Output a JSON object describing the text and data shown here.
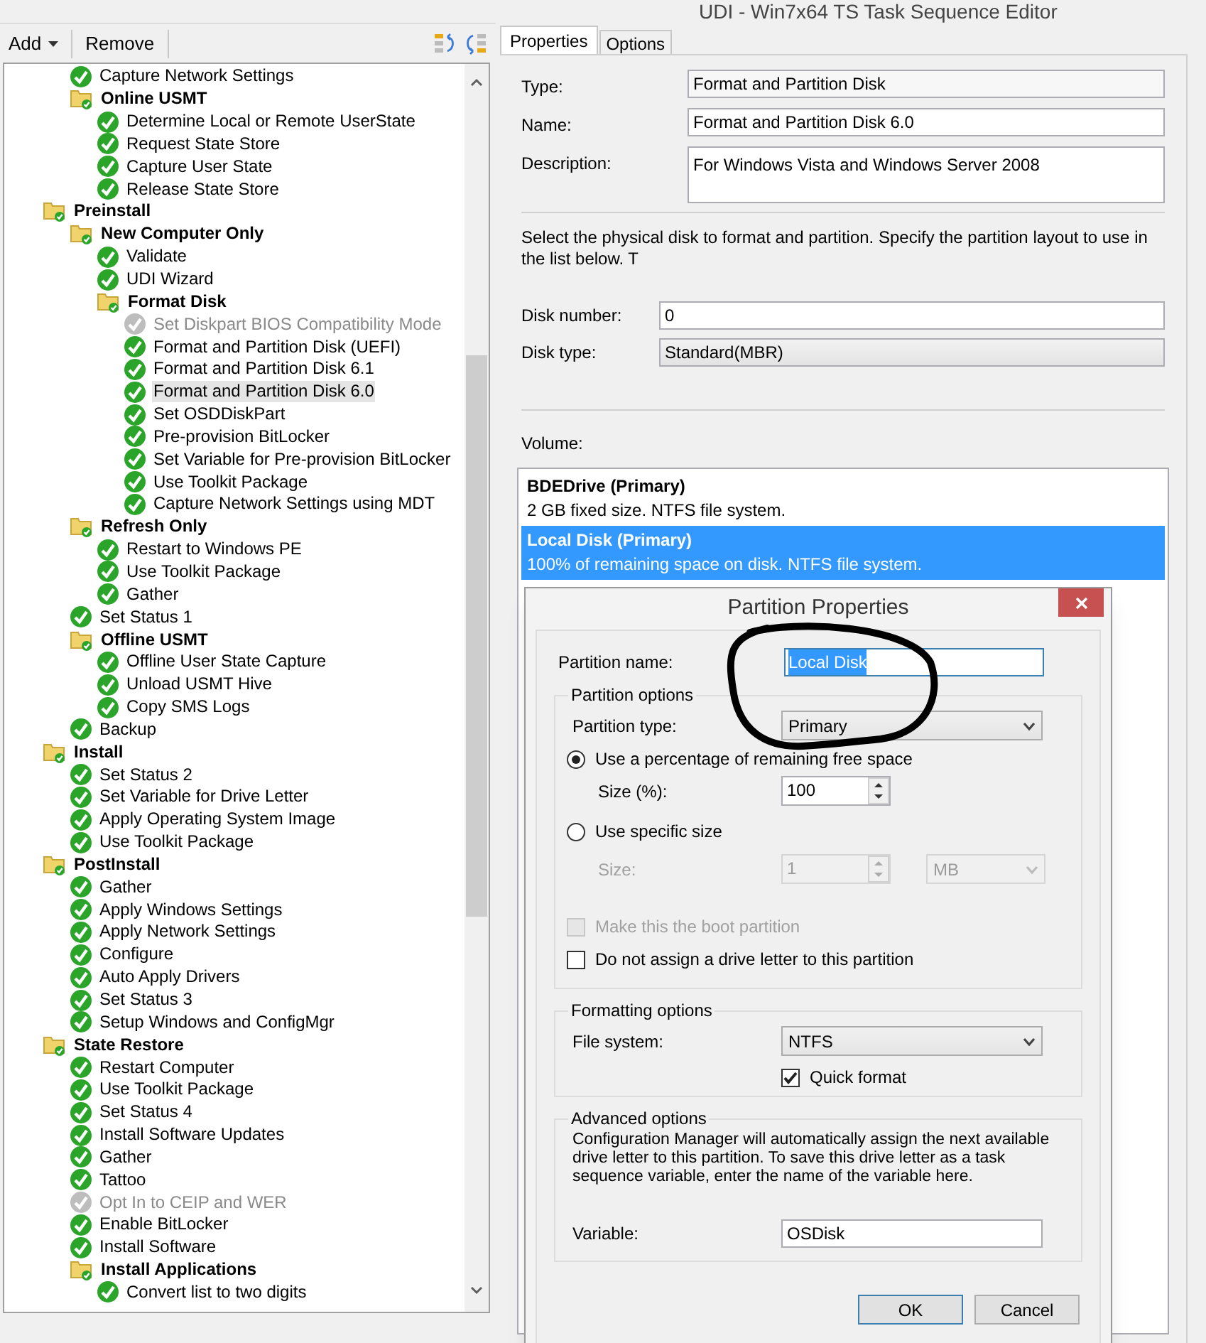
{
  "window": {
    "title": "UDI - Win7x64 TS Task Sequence Editor"
  },
  "toolbar": {
    "buttons": [
      {
        "label": "Add",
        "kind": "dropdown"
      },
      {
        "label": "Remove",
        "kind": "plain"
      }
    ]
  },
  "tree": {
    "partial_branch": [
      {
        "label": "Capture Network Settings",
        "kind": "step",
        "disabled": false,
        "selected": false
      },
      {
        "label": "Online USMT",
        "kind": "group",
        "selected": false,
        "children": [
          {
            "label": "Determine Local or Remote UserState",
            "kind": "step",
            "disabled": false,
            "selected": false
          },
          {
            "label": "Request State Store",
            "kind": "step",
            "disabled": false,
            "selected": false
          },
          {
            "label": "Capture User State",
            "kind": "step",
            "disabled": false,
            "selected": false
          },
          {
            "label": "Release State Store",
            "kind": "step",
            "disabled": false,
            "selected": false
          }
        ]
      }
    ],
    "items": [
      {
        "label": "Preinstall",
        "kind": "group",
        "selected": false,
        "children": [
          {
            "label": "New Computer Only",
            "kind": "group",
            "selected": false,
            "children": [
              {
                "label": "Validate",
                "kind": "step",
                "disabled": false,
                "selected": false
              },
              {
                "label": "UDI Wizard",
                "kind": "step",
                "disabled": false,
                "selected": false
              },
              {
                "label": "Format Disk",
                "kind": "group",
                "selected": false,
                "children": [
                  {
                    "label": "Set Diskpart BIOS Compatibility Mode",
                    "kind": "step",
                    "disabled": true,
                    "selected": false
                  },
                  {
                    "label": "Format and Partition Disk (UEFI)",
                    "kind": "step",
                    "disabled": false,
                    "selected": false
                  },
                  {
                    "label": "Format and Partition Disk 6.1",
                    "kind": "step",
                    "disabled": false,
                    "selected": false
                  },
                  {
                    "label": "Format and Partition Disk 6.0",
                    "kind": "step",
                    "disabled": false,
                    "selected": true
                  },
                  {
                    "label": "Set OSDDiskPart",
                    "kind": "step",
                    "disabled": false,
                    "selected": false
                  },
                  {
                    "label": "Pre-provision BitLocker",
                    "kind": "step",
                    "disabled": false,
                    "selected": false
                  },
                  {
                    "label": "Set Variable for Pre-provision BitLocker",
                    "kind": "step",
                    "disabled": false,
                    "selected": false
                  },
                  {
                    "label": "Use Toolkit Package",
                    "kind": "step",
                    "disabled": false,
                    "selected": false
                  },
                  {
                    "label": "Capture Network Settings using MDT",
                    "kind": "step",
                    "disabled": false,
                    "selected": false
                  }
                ]
              }
            ]
          },
          {
            "label": "Refresh Only",
            "kind": "group",
            "selected": false,
            "children": [
              {
                "label": "Restart to Windows PE",
                "kind": "step",
                "disabled": false,
                "selected": false
              },
              {
                "label": "Use Toolkit Package",
                "kind": "step",
                "disabled": false,
                "selected": false
              },
              {
                "label": "Gather",
                "kind": "step",
                "disabled": false,
                "selected": false
              }
            ]
          },
          {
            "label": "Set Status 1",
            "kind": "step",
            "disabled": false,
            "selected": false
          },
          {
            "label": "Offline USMT",
            "kind": "group",
            "selected": false,
            "children": [
              {
                "label": "Offline User State Capture",
                "kind": "step",
                "disabled": false,
                "selected": false
              },
              {
                "label": "Unload USMT Hive",
                "kind": "step",
                "disabled": false,
                "selected": false
              },
              {
                "label": "Copy SMS Logs",
                "kind": "step",
                "disabled": false,
                "selected": false
              }
            ]
          },
          {
            "label": "Backup",
            "kind": "step",
            "disabled": false,
            "selected": false
          }
        ]
      },
      {
        "label": "Install",
        "kind": "group",
        "selected": false,
        "children": [
          {
            "label": "Set Status 2",
            "kind": "step",
            "disabled": false,
            "selected": false
          },
          {
            "label": "Set Variable for Drive Letter",
            "kind": "step",
            "disabled": false,
            "selected": false
          },
          {
            "label": "Apply Operating System Image",
            "kind": "step",
            "disabled": false,
            "selected": false
          },
          {
            "label": "Use Toolkit Package",
            "kind": "step",
            "disabled": false,
            "selected": false
          }
        ]
      },
      {
        "label": "PostInstall",
        "kind": "group",
        "selected": false,
        "children": [
          {
            "label": "Gather",
            "kind": "step",
            "disabled": false,
            "selected": false
          },
          {
            "label": "Apply Windows Settings",
            "kind": "step",
            "disabled": false,
            "selected": false
          },
          {
            "label": "Apply Network Settings",
            "kind": "step",
            "disabled": false,
            "selected": false
          },
          {
            "label": "Configure",
            "kind": "step",
            "disabled": false,
            "selected": false
          },
          {
            "label": "Auto Apply Drivers",
            "kind": "step",
            "disabled": false,
            "selected": false
          },
          {
            "label": "Set Status 3",
            "kind": "step",
            "disabled": false,
            "selected": false
          },
          {
            "label": "Setup Windows and ConfigMgr",
            "kind": "step",
            "disabled": false,
            "selected": false
          }
        ]
      },
      {
        "label": "State Restore",
        "kind": "group",
        "selected": false,
        "children": [
          {
            "label": "Restart Computer",
            "kind": "step",
            "disabled": false,
            "selected": false
          },
          {
            "label": "Use Toolkit Package",
            "kind": "step",
            "disabled": false,
            "selected": false
          },
          {
            "label": "Set Status 4",
            "kind": "step",
            "disabled": false,
            "selected": false
          },
          {
            "label": "Install Software Updates",
            "kind": "step",
            "disabled": false,
            "selected": false
          },
          {
            "label": "Gather",
            "kind": "step",
            "disabled": false,
            "selected": false
          },
          {
            "label": "Tattoo",
            "kind": "step",
            "disabled": false,
            "selected": false
          },
          {
            "label": "Opt In to CEIP and WER",
            "kind": "step",
            "disabled": true,
            "selected": false
          },
          {
            "label": "Enable BitLocker",
            "kind": "step",
            "disabled": false,
            "selected": false
          },
          {
            "label": "Install Software",
            "kind": "step",
            "disabled": false,
            "selected": false
          },
          {
            "label": "Install Applications",
            "kind": "group",
            "selected": false,
            "children": [
              {
                "label": "Convert list to two digits",
                "kind": "step",
                "disabled": false,
                "selected": false
              }
            ]
          }
        ]
      }
    ]
  },
  "tabs": [
    {
      "label": "Properties",
      "selected": true
    },
    {
      "label": "Options",
      "selected": false
    }
  ],
  "properties": {
    "fields": [
      {
        "label": "Type:",
        "value": "Format and Partition Disk",
        "kind": "readonly"
      },
      {
        "label": "Name:",
        "value": "Format and Partition Disk 6.0",
        "kind": "text"
      },
      {
        "label": "Description:",
        "value": "For Windows Vista and Windows Server 2008",
        "kind": "multiline"
      }
    ],
    "instructions": "Select the physical disk to format and partition. Specify the partition layout to use in the list below. T",
    "disk_fields": [
      {
        "label": "Disk number:",
        "value": "0",
        "kind": "text"
      },
      {
        "label": "Disk type:",
        "value": "Standard(MBR)",
        "kind": "combo"
      }
    ],
    "volume_label": "Volume:",
    "volumes": [
      {
        "name": "BDEDrive (Primary)",
        "detail": "2 GB fixed size. NTFS file system.",
        "selected": false
      },
      {
        "name": "Local Disk (Primary)",
        "detail": "100% of remaining space on disk. NTFS file system.",
        "selected": true
      }
    ]
  },
  "dialog": {
    "title": "Partition Properties",
    "partition_name": {
      "label": "Partition name:",
      "value": "Local Disk"
    },
    "partition_options": {
      "legend": "Partition options",
      "type_label": "Partition type:",
      "type_value": "Primary",
      "radios": [
        {
          "label": "Use a percentage of remaining free space",
          "selected": true
        },
        {
          "label": "Use specific size",
          "selected": false
        }
      ],
      "percent": {
        "label": "Size (%):",
        "value": "100",
        "disabled": false
      },
      "size": {
        "label": "Size:",
        "value": "1",
        "unit": "MB",
        "disabled": true
      },
      "checkboxes": [
        {
          "label": "Make this the boot partition",
          "checked": false,
          "disabled": true
        },
        {
          "label": "Do not assign a drive letter to this partition",
          "checked": false,
          "disabled": false
        }
      ]
    },
    "formatting": {
      "legend": "Formatting options",
      "fs_label": "File system:",
      "fs_value": "NTFS",
      "quick_format": {
        "label": "Quick format",
        "checked": true,
        "disabled": false
      }
    },
    "advanced": {
      "legend": "Advanced options",
      "text": "Configuration Manager will automatically assign the next available drive letter to this partition. To save this drive letter as a task sequence variable, enter the name of the variable here.",
      "variable_label": "Variable:",
      "variable_value": "OSDisk"
    },
    "buttons": [
      {
        "label": "OK",
        "default": true
      },
      {
        "label": "Cancel",
        "default": false
      }
    ]
  }
}
